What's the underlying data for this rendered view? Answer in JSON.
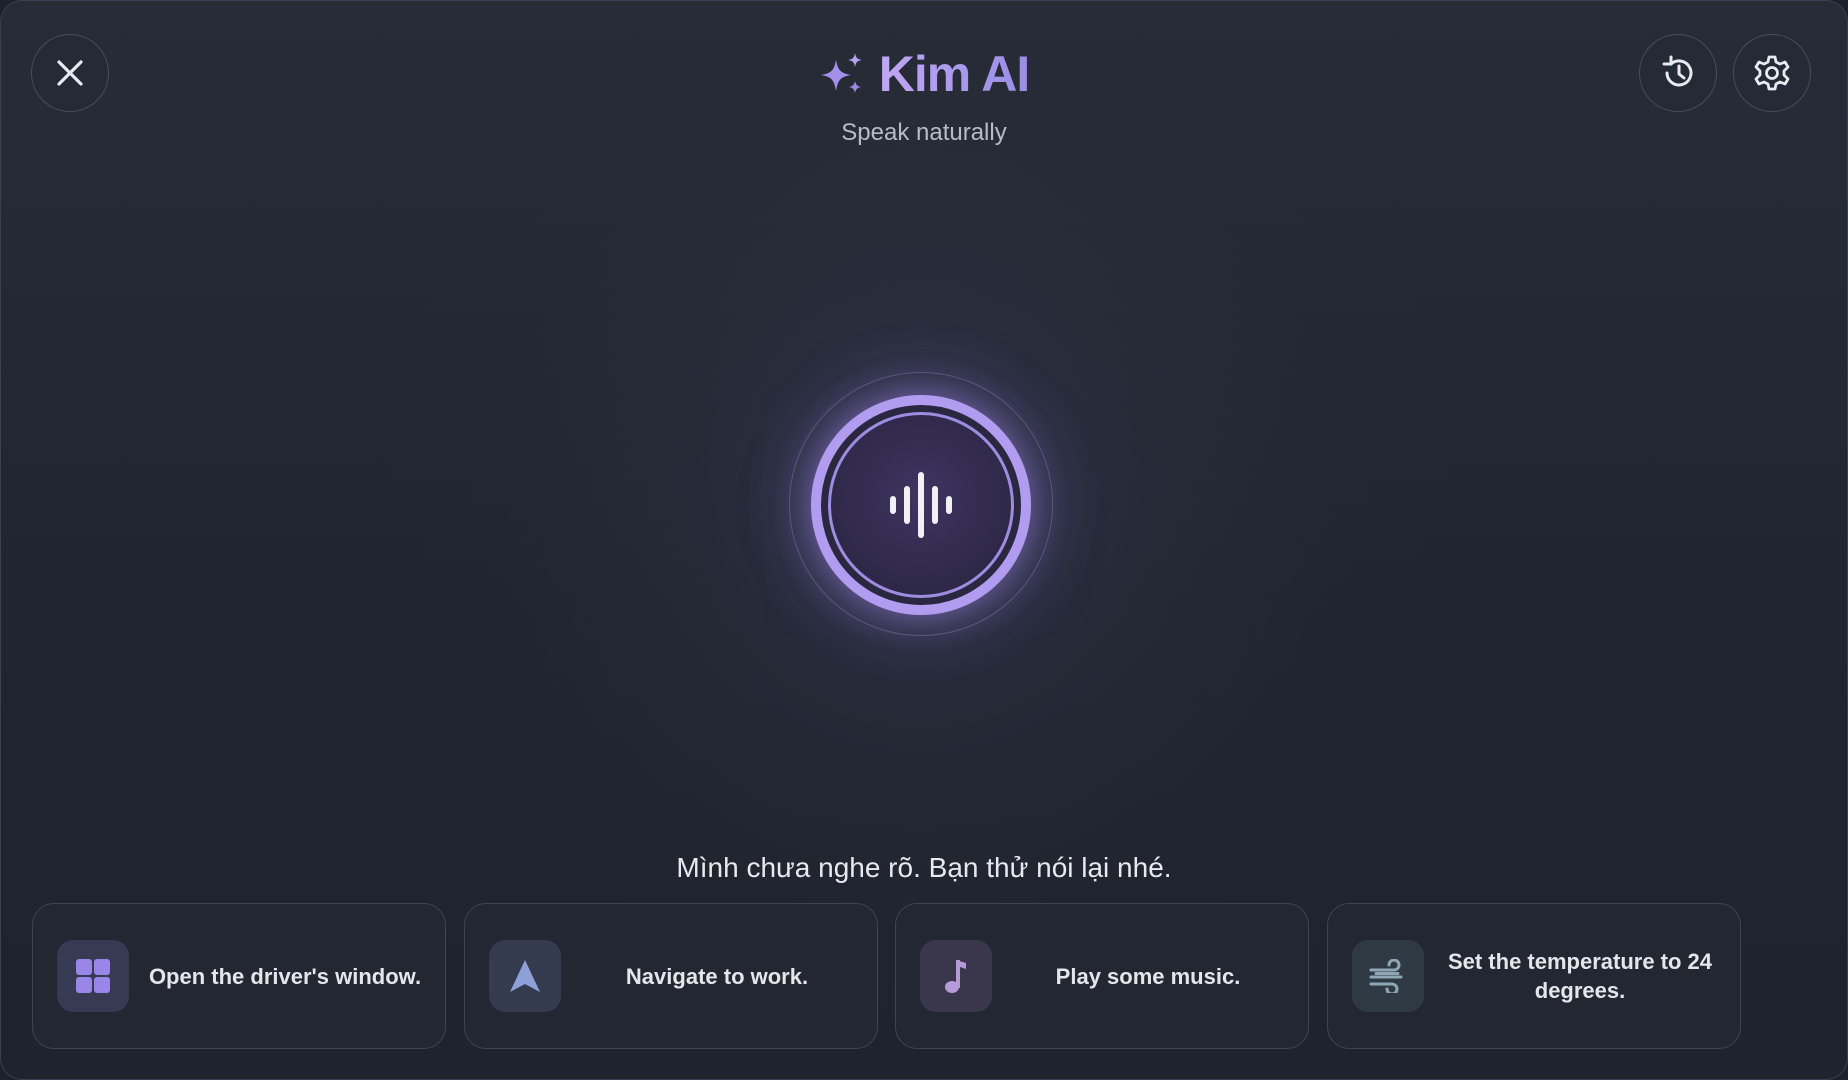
{
  "header": {
    "title": "Kim AI",
    "subtitle": "Speak naturally",
    "title_icon": "sparkles-icon",
    "left_button": "close-icon",
    "right_buttons": [
      "history-icon",
      "gear-icon"
    ]
  },
  "voice": {
    "button_icon": "voice-waveform-icon",
    "status_text": "Mình chưa nghe rõ. Bạn thử nói lại nhé."
  },
  "suggestions": [
    {
      "icon": "grid-icon",
      "label": "Open the driver's window.",
      "icon_color": "#9a86e6"
    },
    {
      "icon": "navigation-arrow-icon",
      "label": "Navigate to work.",
      "icon_color": "#8ea0d8"
    },
    {
      "icon": "music-note-icon",
      "label": "Play some music.",
      "icon_color": "#b69ad8"
    },
    {
      "icon": "wind-icon",
      "label": "Set the temperature to 24 degrees.",
      "icon_color": "#8fa6b6"
    }
  ],
  "colors": {
    "accent": "#b29cf0",
    "background": "#20252f",
    "text": "#e7e9ee",
    "muted_text": "#b7bcc7"
  }
}
